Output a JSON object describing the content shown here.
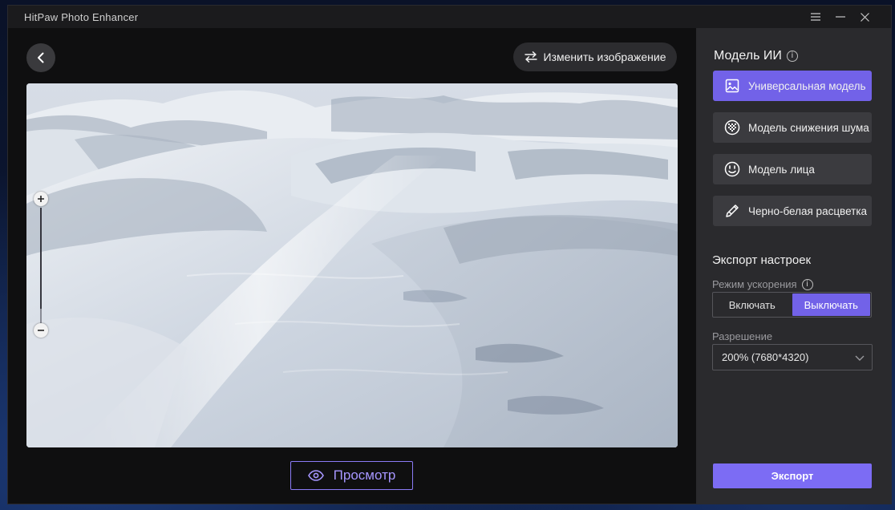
{
  "window": {
    "title": "HitPaw Photo Enhancer"
  },
  "toolbar": {
    "change_image_label": "Изменить изображение"
  },
  "preview": {
    "button_label": "Просмотр"
  },
  "panel": {
    "model_heading": "Модель ИИ",
    "models": [
      {
        "label": "Универсальная модель",
        "icon": "image-icon",
        "active": true
      },
      {
        "label": "Модель снижения шума",
        "icon": "noise-reduction-icon",
        "active": false
      },
      {
        "label": "Модель лица",
        "icon": "face-icon",
        "active": false
      },
      {
        "label": "Черно-белая расцветка",
        "icon": "colorize-icon",
        "active": false
      }
    ],
    "export_settings_heading": "Экспорт настроек",
    "acceleration_label": "Режим ускорения",
    "acceleration_options": [
      "Включать",
      "Выключать"
    ],
    "acceleration_selected": "Выключать",
    "resolution_label": "Разрешение",
    "resolution_value": "200% (7680*4320)",
    "export_label": "Экспорт"
  },
  "colors": {
    "accent": "#7262e8",
    "export_button": "#7c6cf4",
    "preview_outline": "#8b7bf6",
    "panel_bg": "#2a2a2d",
    "canvas_bg": "#0f0f10"
  }
}
